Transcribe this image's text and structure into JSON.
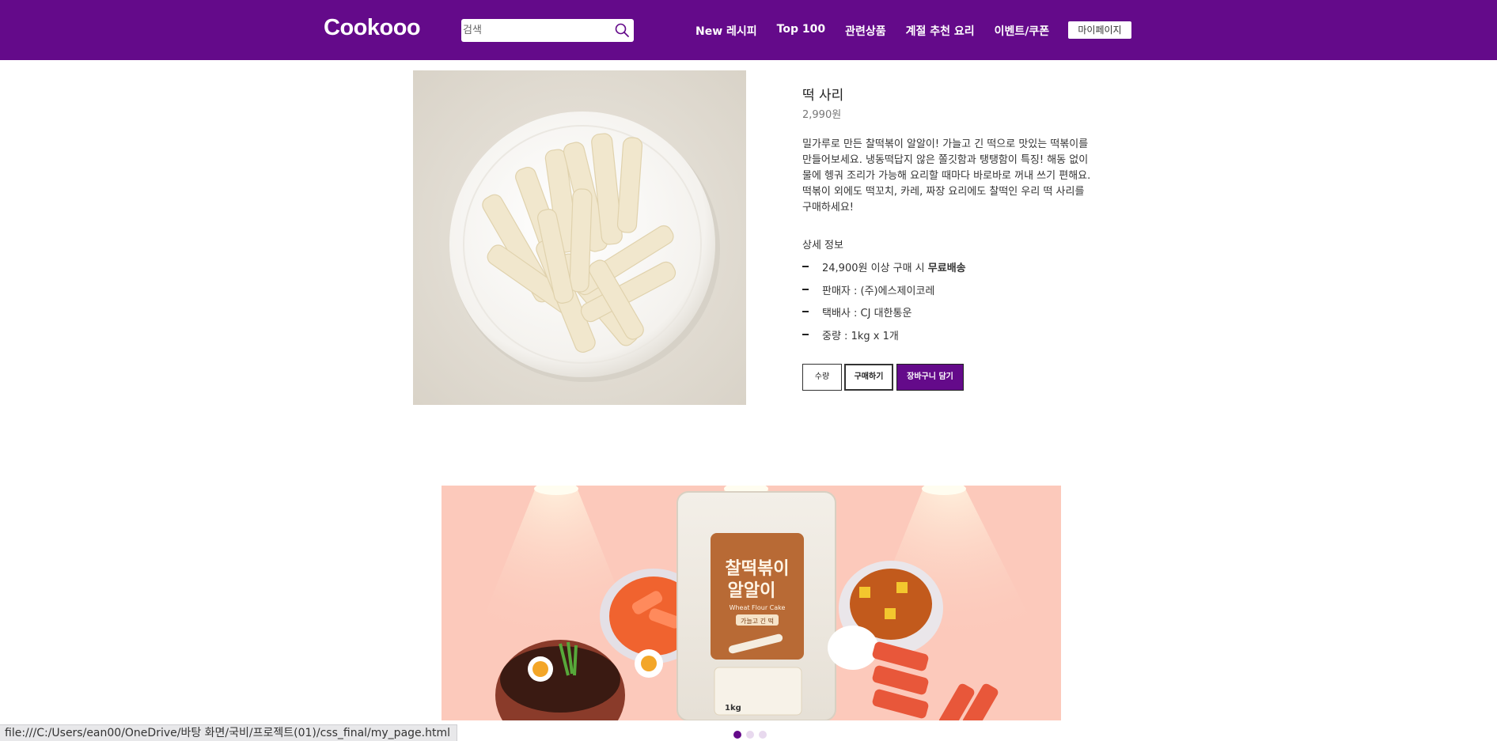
{
  "header": {
    "logo": "Cookooo",
    "search_placeholder": "검색",
    "nav": [
      "New 레시피",
      "Top 100",
      "관련상품",
      "계절 추천 요리",
      "이벤트/쿠폰"
    ],
    "mypage_label": "마이페이지"
  },
  "product": {
    "title": "떡 사리",
    "price": "2,990원",
    "description": "밀가루로 만든 찰떡볶이 알알이! 가늘고 긴 떡으로 맛있는 떡볶이를 만들어보세요. 냉동떡답지 않은 쫄깃함과 탱탱함이 특징! 해동 없이 물에 헹궈 조리가 가능해 요리할 때마다 바로바로 꺼내 쓰기 편해요. 떡볶이 외에도 떡꼬치, 카레, 짜장 요리에도 찰떡인 우리 떡 사리를 구매하세요!",
    "detail_heading": "상세 정보",
    "details": [
      {
        "prefix": "24,900원 이상 구매 시 ",
        "strong": "무료배송"
      },
      {
        "prefix": "판매자 : (주)에스제이코레",
        "strong": ""
      },
      {
        "prefix": "택배사 : CJ 대한통운",
        "strong": ""
      },
      {
        "prefix": "중량 : 1kg x 1개",
        "strong": ""
      }
    ],
    "buttons": {
      "quantity": "수량",
      "buy": "구매하기",
      "cart": "장바구니 담기"
    }
  },
  "banner": {
    "package_title_1": "찰떡볶이",
    "package_title_2": "알알이",
    "package_sub": "Wheat Flour Cake",
    "package_tag": "가늘고 긴 떡",
    "package_weight": "1kg",
    "slide_count": 3,
    "active_slide": 1
  },
  "statusbar": {
    "url": "file:///C:/Users/ean00/OneDrive/바탕 화면/국비/프로젝트(01)/css_final/my_page.html"
  },
  "colors": {
    "brand": "#640a8a",
    "banner_bg": "#fcc9bb"
  }
}
